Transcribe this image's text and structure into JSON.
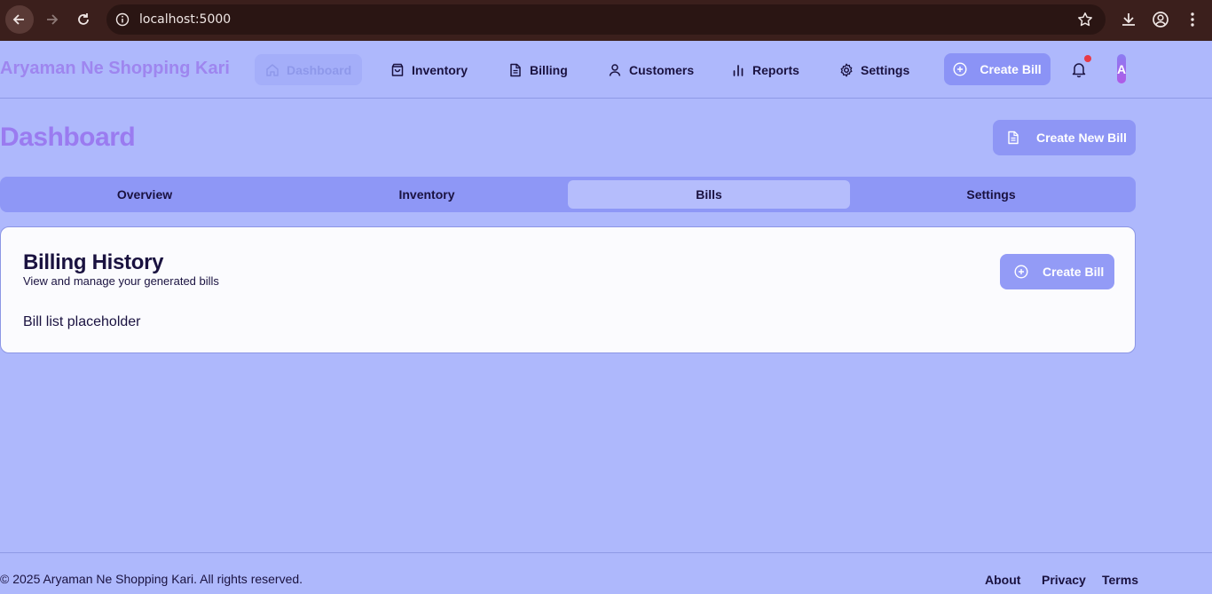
{
  "browser": {
    "url": "localhost:5000"
  },
  "header": {
    "brand": "Aryaman Ne Shopping Kari",
    "nav": [
      {
        "label": "Dashboard",
        "icon": "home-icon",
        "active": true
      },
      {
        "label": "Inventory",
        "icon": "shopping-bag-icon"
      },
      {
        "label": "Billing",
        "icon": "document-icon"
      },
      {
        "label": "Customers",
        "icon": "user-icon"
      },
      {
        "label": "Reports",
        "icon": "bar-chart-icon"
      },
      {
        "label": "Settings",
        "icon": "gear-icon"
      }
    ],
    "create_bill_label": "Create Bill",
    "avatar_initial": "A"
  },
  "page": {
    "title": "Dashboard",
    "create_new_bill_label": "Create New Bill"
  },
  "tabs": [
    {
      "label": "Overview"
    },
    {
      "label": "Inventory"
    },
    {
      "label": "Bills",
      "active": true
    },
    {
      "label": "Settings"
    }
  ],
  "card": {
    "title": "Billing History",
    "subtitle": "View and manage your generated bills",
    "create_label": "Create Bill",
    "placeholder": "Bill list placeholder"
  },
  "footer": {
    "copyright": "© 2025 Aryaman Ne Shopping Kari. All rights reserved.",
    "links": [
      "About",
      "Privacy",
      "Terms"
    ]
  },
  "colors": {
    "background": "#aeb8fc",
    "accent": "#8b93f6",
    "chrome": "#3b1f1c",
    "notification": "#e83a46"
  }
}
